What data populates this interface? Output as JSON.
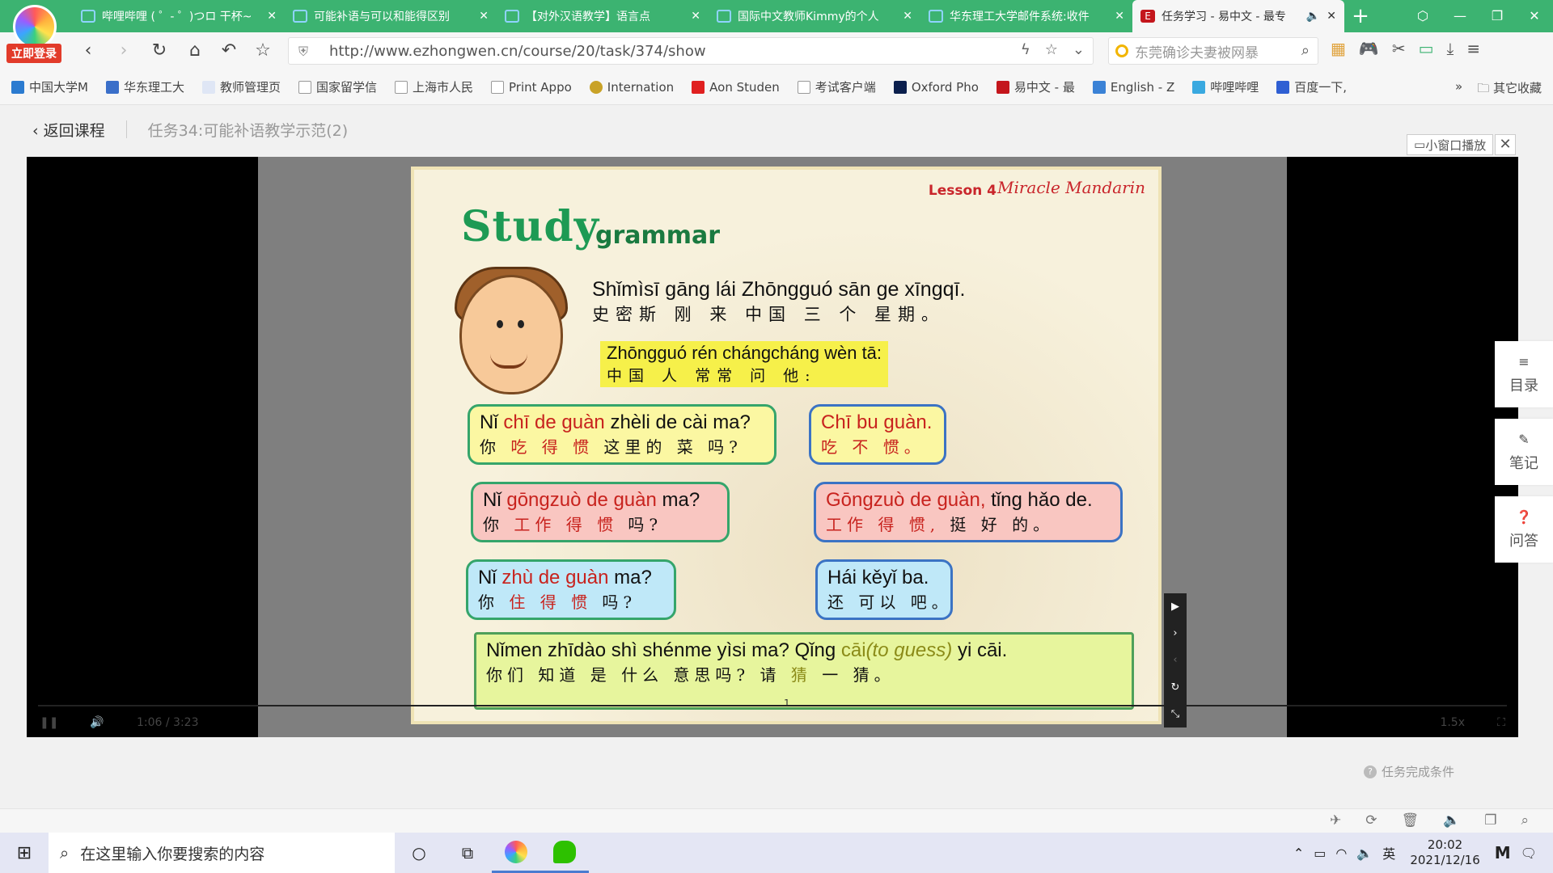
{
  "browser": {
    "login_badge": "立即登录",
    "tabs": [
      {
        "title": "哔哩哔哩 ( ゜- ゜)つロ 干杯~",
        "active": false
      },
      {
        "title": "可能补语与可以和能得区别",
        "active": false
      },
      {
        "title": "【对外汉语教学】语言点",
        "active": false
      },
      {
        "title": "国际中文教师Kimmy的个人",
        "active": false
      },
      {
        "title": "华东理工大学邮件系统:收件",
        "active": false
      },
      {
        "title": "任务学习 - 易中文 - 最专",
        "active": true
      }
    ],
    "url": "http://www.ezhongwen.cn/course/20/task/374/show",
    "search_placeholder": "东莞确诊夫妻被网暴",
    "bookmarks": [
      "中国大学M",
      "华东理工大",
      "教师管理页",
      "国家留学信",
      "上海市人民",
      "Print Appo",
      "Internation",
      "Aon Studen",
      "考试客户端",
      "Oxford Pho",
      "易中文 - 最",
      "English - Z",
      "哔哩哔哩",
      "百度一下,"
    ],
    "bookmarks_more": "»",
    "other_bookmarks": "其它收藏"
  },
  "page": {
    "back_label": "返回课程",
    "task_title": "任务34:可能补语教学示范(2)",
    "mini_player_label": "小窗口播放",
    "close_label": "✕",
    "task_condition": "任务完成条件"
  },
  "side_rail": [
    {
      "icon": "menu-icon",
      "label": "目录"
    },
    {
      "icon": "pencil-icon",
      "label": "笔记"
    },
    {
      "icon": "question-icon",
      "label": "问答"
    }
  ],
  "player": {
    "time": "1:06 / 3:23",
    "speed": "1.5x"
  },
  "slide": {
    "lesson": "Lesson 4",
    "brand": "Miracle Mandarin",
    "study": "Study",
    "grammar": "grammar",
    "sentence1": {
      "pinyin": "Shǐmìsī gāng lái Zhōngguó sān ge xīngqī.",
      "hanzi": "史密斯  刚 来  中国  三 个  星期。"
    },
    "sentence2": {
      "pinyin": "Zhōngguó rén chángcháng wèn tā:",
      "hanzi": "中国  人  常常  问 他:"
    },
    "b1": {
      "p_pre": "Nǐ ",
      "p_hl": "chī de guàn",
      "p_post": " zhèli de cài ma?",
      "h_pre": "你 ",
      "h_hl": "吃 得 惯",
      "h_post": "  这里的 菜 吗?"
    },
    "b2": {
      "p_hl": "Chī bu guàn.",
      "h_hl": "吃 不 惯。"
    },
    "b3": {
      "p_pre": "Nǐ ",
      "p_hl": "gōngzuò de guàn",
      "p_post": " ma?",
      "h_pre": "你 ",
      "h_hl": "工作  得 惯",
      "h_post": "  吗?"
    },
    "b4": {
      "p_hl": "Gōngzuò de guàn,",
      "p_post": " tǐng hǎo de.",
      "h_hl": "工作   得 惯,",
      "h_post": "  挺 好 的。"
    },
    "b5": {
      "p_pre": "Nǐ ",
      "p_hl": "zhù de guàn",
      "p_post": " ma?",
      "h_pre": "你 ",
      "h_hl": "住 得 惯",
      "h_post": " 吗?"
    },
    "b6": {
      "pinyin": "Hái kěyǐ ba.",
      "hanzi": "还 可以 吧。"
    },
    "b7": {
      "p_pre": "Nǐmen zhīdào shì shénme yìsi ma? Qǐng ",
      "p_hl": "cāi",
      "p_hl2": "(to guess)",
      "p_post": " yi cāi.",
      "h_pre": "你们   知道  是   什么 意思吗?  请  ",
      "h_hl": "猜",
      "h_post": "         一 猜。"
    },
    "page_num": "1"
  },
  "taskbar": {
    "search_placeholder": "在这里输入你要搜索的内容",
    "time": "20:02",
    "date": "2021/12/16",
    "ime": "英"
  }
}
